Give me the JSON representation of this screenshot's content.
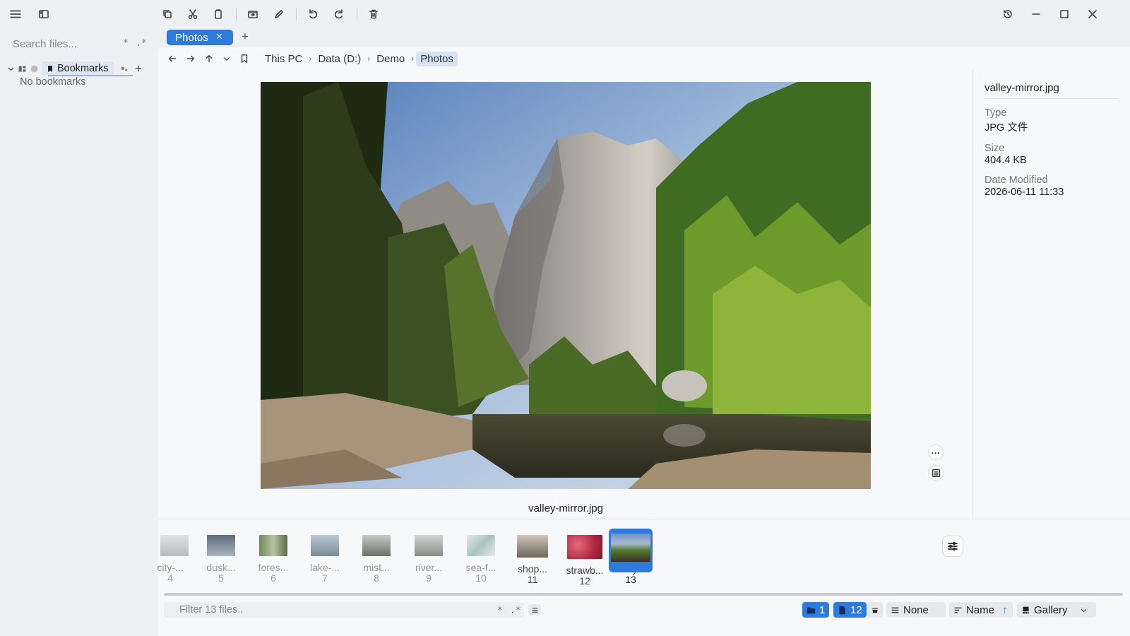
{
  "sidebar": {
    "search_placeholder": "Search files...",
    "star": "*",
    "regex": ".*",
    "bookmarks_label": "Bookmarks",
    "no_bookmarks": "No bookmarks"
  },
  "tabs": [
    {
      "label": "Photos"
    }
  ],
  "tab_close": "✕",
  "tab_add": "+",
  "breadcrumb": [
    "This PC",
    "Data (D:)",
    "Demo",
    "Photos"
  ],
  "breadcrumb_sep": "›",
  "preview": {
    "filename": "valley-mirror.jpg"
  },
  "info": {
    "name": "valley-mirror.jpg",
    "type_label": "Type",
    "type_value": "JPG 文件",
    "size_label": "Size",
    "size_value": "404.4 KB",
    "date_label": "Date Modified",
    "date_value": "2026-06-11 11:33"
  },
  "side_more": "...",
  "gallery": [
    {
      "name": "city-...",
      "num": "4"
    },
    {
      "name": "dusk...",
      "num": "5"
    },
    {
      "name": "fores...",
      "num": "6"
    },
    {
      "name": "lake-...",
      "num": "7"
    },
    {
      "name": "mist...",
      "num": "8"
    },
    {
      "name": "river...",
      "num": "9"
    },
    {
      "name": "sea-f...",
      "num": "10"
    },
    {
      "name": "shop...",
      "num": "11"
    },
    {
      "name": "strawb...",
      "num": "12"
    },
    {
      "name": "valley-...",
      "num": "13"
    }
  ],
  "status": {
    "filter_placeholder": "Filter 13 files..",
    "star": "*",
    "regex": ".*",
    "folders_count": "1",
    "files_count": "12",
    "group_value": "None",
    "sort_value": "Name",
    "sort_dir": "↑",
    "view_value": "Gallery"
  },
  "colors": {
    "accent": "#2f7bdc"
  }
}
